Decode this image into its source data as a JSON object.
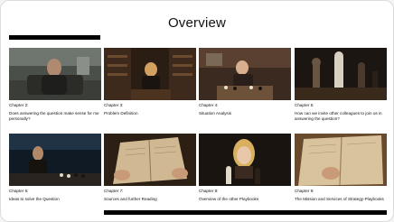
{
  "slide": {
    "title": "Overview"
  },
  "cards": [
    {
      "chapter": "Chapter 2:",
      "description": "Does answering the question make sense for me personally?",
      "image": "man-seated-on-sofa-photo"
    },
    {
      "chapter": "Chapter 3:",
      "description": "Problem Definition",
      "image": "library-reading-photo"
    },
    {
      "chapter": "Chapter 4:",
      "description": "Situation Analysis",
      "image": "girl-at-chessboard-photo"
    },
    {
      "chapter": "Chapter 5:",
      "description": "How can we invite other colleagues to join us in answering the question?",
      "image": "chess-pieces-closeup-photo"
    },
    {
      "chapter": "Chapter 6:",
      "description": "Ideas to solve the Question",
      "image": "man-in-chess-hall-photo"
    },
    {
      "chapter": "Chapter 7:",
      "description": "Sources and further Reading",
      "image": "hands-holding-book-photo"
    },
    {
      "chapter": "Chapter 8:",
      "description": "Overview of the other Playbooks",
      "image": "woman-behind-chess-pieces-photo"
    },
    {
      "chapter": "Chapter 9:",
      "description": "The Mission and Services of Strategy-Playbooks",
      "image": "reading-book-closeup-photo"
    }
  ],
  "colors": {
    "accent_bar": "#000000",
    "background": "#ffffff"
  }
}
